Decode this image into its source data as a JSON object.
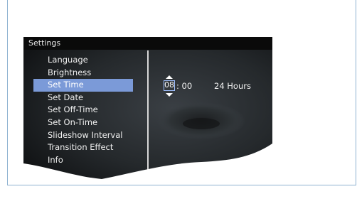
{
  "window": {
    "title": "Settings"
  },
  "menu": {
    "items": [
      {
        "label": "Language"
      },
      {
        "label": "Brightness"
      },
      {
        "label": "Set Time"
      },
      {
        "label": "Set Date"
      },
      {
        "label": "Set Off-Time"
      },
      {
        "label": "Set On-Time"
      },
      {
        "label": "Slideshow Interval"
      },
      {
        "label": "Transition Effect"
      },
      {
        "label": "Info"
      }
    ],
    "selected_index": 2,
    "selected_color": "#7b9ad8"
  },
  "time_setting": {
    "hour": "08",
    "separator_minutes": ": 00",
    "format": "24 Hours",
    "up_icon": "triangle-up-icon",
    "down_icon": "triangle-down-icon"
  }
}
